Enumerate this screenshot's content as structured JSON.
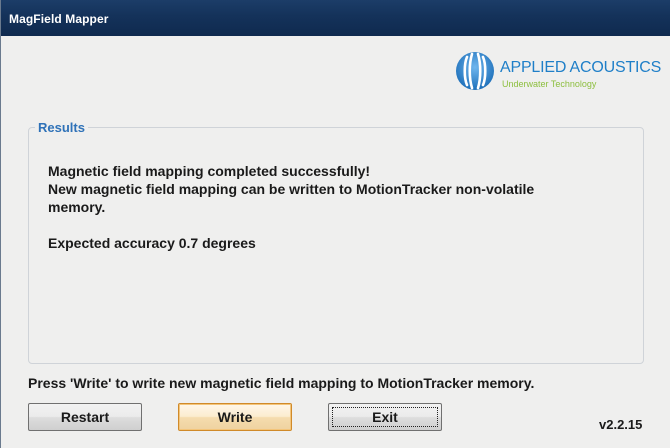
{
  "window": {
    "title": "MagField Mapper"
  },
  "logo": {
    "icon": "applied-acoustics-logo-icon",
    "name": "APPLIED ACOUSTICS",
    "tagline": "Underwater Technology",
    "colors": {
      "name": "#1f7fc8",
      "tagline": "#8dbf3f",
      "mark": "#3d8fd6"
    }
  },
  "results": {
    "legend": "Results",
    "lines": [
      "Magnetic field mapping completed successfully!",
      "New magnetic field mapping can be written to MotionTracker non-volatile",
      "memory.",
      "Expected accuracy 0.7 degrees"
    ]
  },
  "prompt": "Press 'Write' to write new magnetic field mapping to MotionTracker memory.",
  "buttons": {
    "restart": "Restart",
    "write": "Write",
    "exit": "Exit"
  },
  "version": "v2.2.15",
  "colors": {
    "titlebar": "#14325a",
    "background": "#efefee",
    "legend": "#2f72b8",
    "write_button_border": "#d08a2a"
  }
}
